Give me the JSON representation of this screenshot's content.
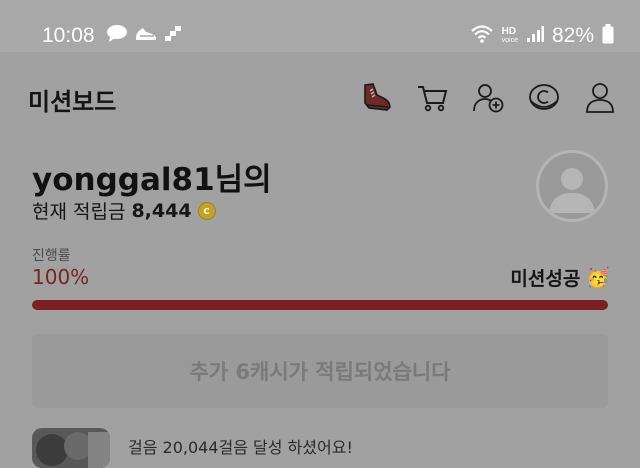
{
  "status_bar": {
    "time": "10:08",
    "hd_label": "HD",
    "voice_label": "voice",
    "battery_percent": "82%"
  },
  "header": {
    "title": "미션보드",
    "icons": [
      "shoe-icon",
      "cart-icon",
      "add-user-icon",
      "coin-c-icon",
      "user-icon"
    ]
  },
  "profile": {
    "username": "yonggal81님의",
    "balance_label": "현재 적립금",
    "balance_value": "8,444",
    "coin_symbol": "c"
  },
  "progress": {
    "label": "진행률",
    "value_text": "100%",
    "fraction": 1.0,
    "mission_status": "미션성공",
    "mission_emoji": "🥳"
  },
  "banner": {
    "message": "추가 6캐시가 적립되었습니다"
  },
  "feed": {
    "partial_text": "걸음 20,044걸음 달성 하셨어요!"
  },
  "colors": {
    "overlay_background": "#a1a1a1",
    "progress_fill": "#7a1f24",
    "progress_value_text": "#7a2323",
    "coin": "#c2a22b"
  }
}
